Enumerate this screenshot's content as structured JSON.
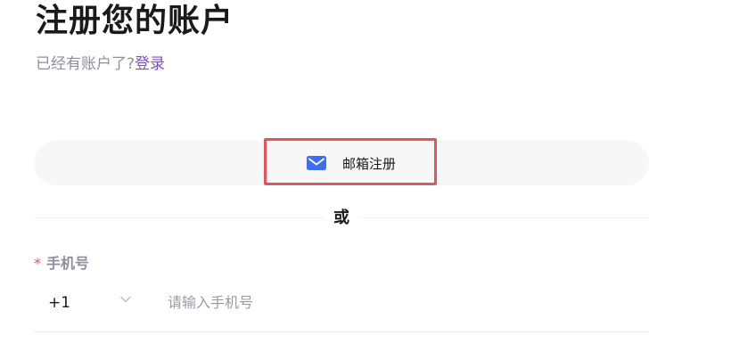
{
  "header": {
    "title": "注册您的账户",
    "have_account_text": "已经有账户了?",
    "login_link": "登录"
  },
  "email_signup": {
    "label": "邮箱注册",
    "icon": "mail-icon",
    "icon_color": "#3d6df2"
  },
  "divider": {
    "or_text": "或"
  },
  "phone_field": {
    "label": "手机号",
    "required_mark": "*",
    "country_code": "+1",
    "placeholder": "请输入手机号",
    "value": ""
  },
  "colors": {
    "accent_link": "#7b4dd6",
    "highlight_border": "#e5545a",
    "required": "#e5545a"
  }
}
